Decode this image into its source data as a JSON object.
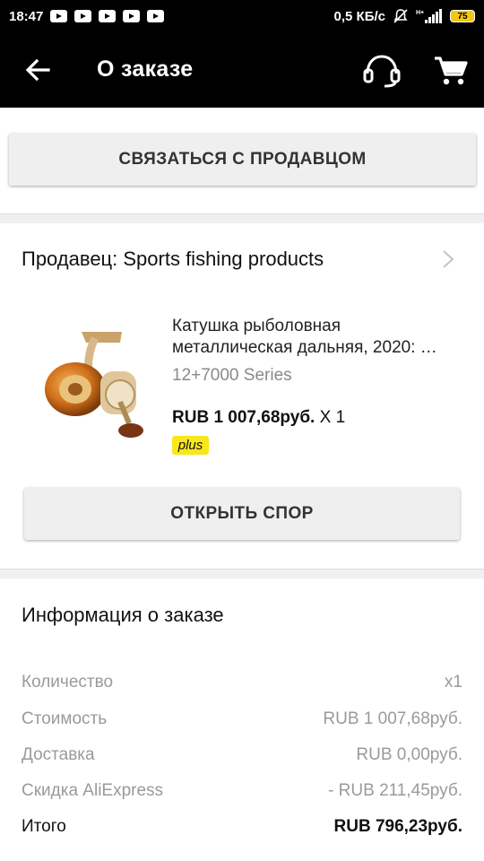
{
  "status_bar": {
    "time": "18:47",
    "network_speed": "0,5 КБ/с",
    "battery": "75",
    "icons": [
      "youtube-icon",
      "youtube-icon",
      "youtube-icon",
      "youtube-icon",
      "youtube-icon",
      "mute-icon",
      "signal-icon",
      "battery-icon"
    ]
  },
  "app_bar": {
    "title": "О заказе",
    "icons": [
      "back-arrow-icon",
      "support-headset-icon",
      "cart-icon"
    ]
  },
  "contact_button": {
    "label": "СВЯЗАТЬСЯ С ПРОДАВЦОМ"
  },
  "seller": {
    "label": "Продавец: Sports fishing products"
  },
  "product": {
    "title_line1": "Катушка рыболовная",
    "title_line2": "металлическая дальняя, 2020: …",
    "variant": "12+7000 Series",
    "price": "RUB 1 007,68руб.",
    "quantity": "X 1",
    "badge": "plus",
    "badge_color": "#f8e71c"
  },
  "dispute_button": {
    "label": "ОТКРЫТЬ СПОР"
  },
  "order_info": {
    "heading": "Информация о заказе",
    "rows": [
      {
        "label": "Количество",
        "value": "x1"
      },
      {
        "label": "Стоимость",
        "value": "RUB 1 007,68руб."
      },
      {
        "label": "Доставка",
        "value": "RUB 0,00руб."
      },
      {
        "label": "Скидка AliExpress",
        "value": "- RUB 211,45руб."
      }
    ],
    "total": {
      "label": "Итого",
      "value": "RUB 796,23руб."
    }
  }
}
